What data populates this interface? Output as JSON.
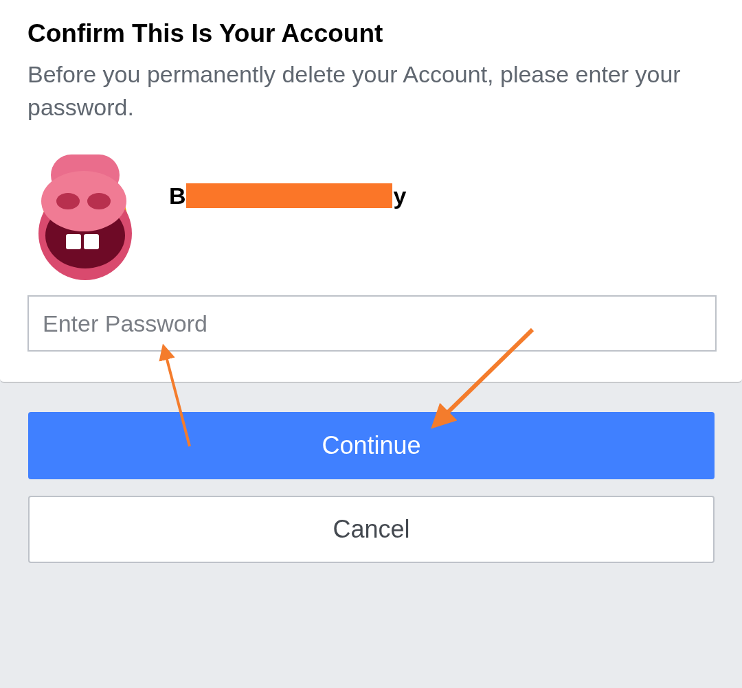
{
  "dialog": {
    "title": "Confirm This Is Your Account",
    "description": "Before you permanently delete your Account, please enter your password.",
    "account": {
      "name_start": "B",
      "name_end": "y"
    },
    "password": {
      "placeholder": "Enter Password"
    }
  },
  "buttons": [
    {
      "label": "Continue",
      "kind": "primary"
    },
    {
      "label": "Cancel",
      "kind": "secondary"
    }
  ]
}
